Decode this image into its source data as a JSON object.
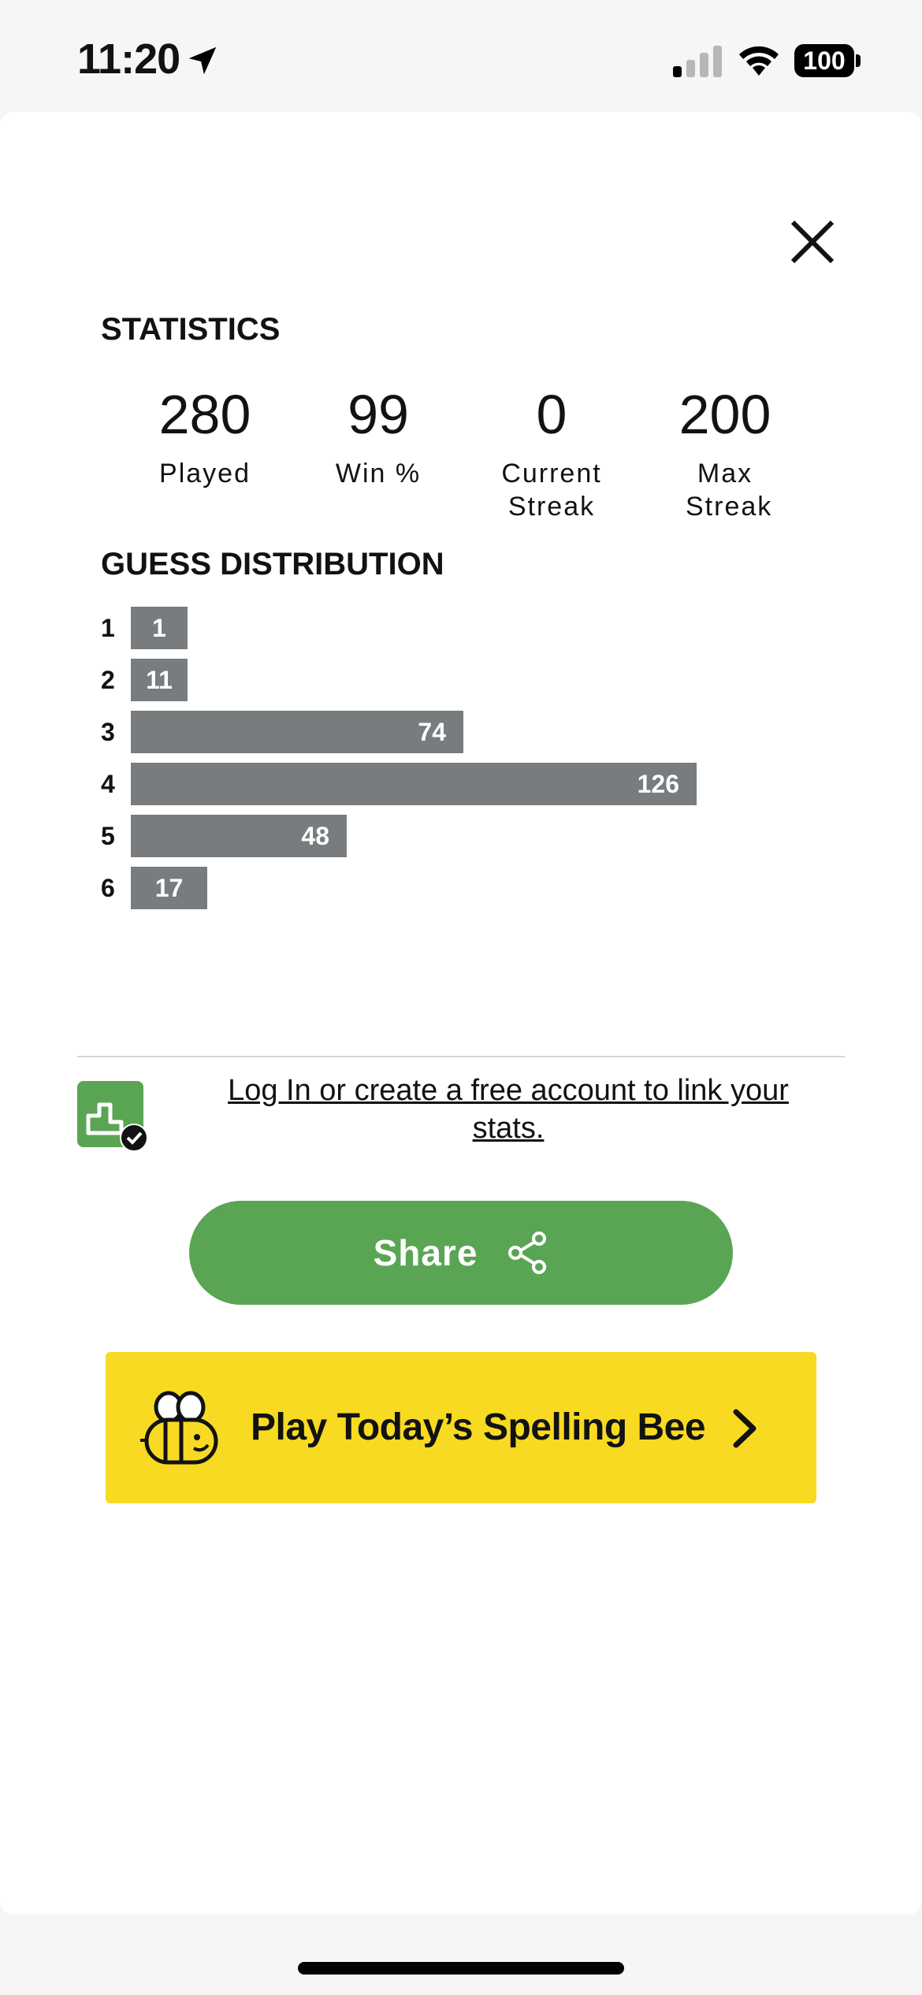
{
  "status_bar": {
    "time": "11:20",
    "battery": "100"
  },
  "statistics": {
    "title": "STATISTICS",
    "items": [
      {
        "value": "280",
        "label": "Played"
      },
      {
        "value": "99",
        "label": "Win %"
      },
      {
        "value": "0",
        "label": "Current Streak"
      },
      {
        "value": "200",
        "label": "Max Streak"
      }
    ]
  },
  "distribution": {
    "title": "GUESS DISTRIBUTION",
    "rows": [
      {
        "guess": "1",
        "count": 1
      },
      {
        "guess": "2",
        "count": 11
      },
      {
        "guess": "3",
        "count": 74
      },
      {
        "guess": "4",
        "count": 126
      },
      {
        "guess": "5",
        "count": 48
      },
      {
        "guess": "6",
        "count": 17
      }
    ]
  },
  "account": {
    "icon": "stats-chart-icon",
    "badge": "verified-check-icon",
    "link_text": "Log In or create a free account to link your stats."
  },
  "share": {
    "label": "Share",
    "icon": "share-icon",
    "color": "#5aa554"
  },
  "promo": {
    "label": "Play Today’s Spelling Bee",
    "icon": "bee-icon",
    "color": "#f7da21"
  },
  "colors": {
    "bar": "#787c7e",
    "text": "#121212"
  }
}
